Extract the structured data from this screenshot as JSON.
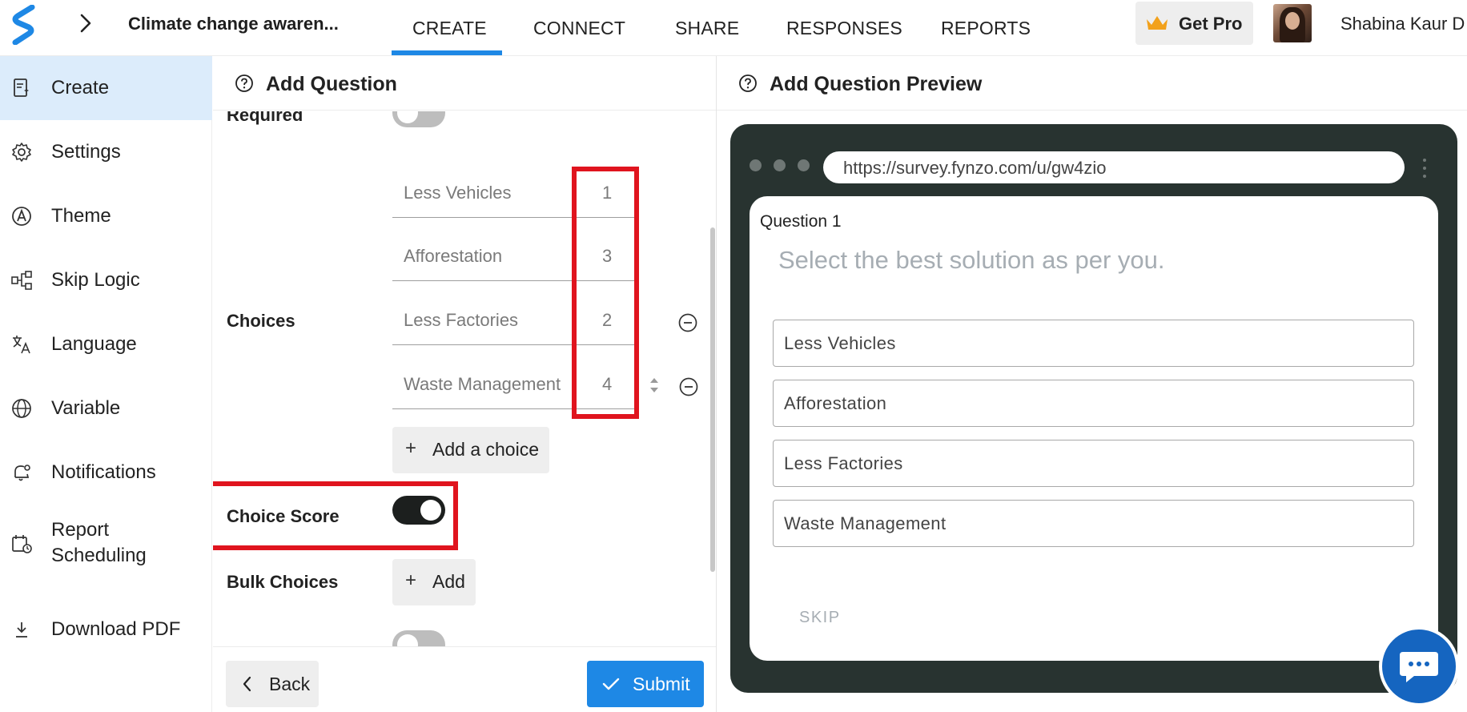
{
  "header": {
    "survey_title": "Climate change awaren...",
    "tabs": [
      {
        "label": "CREATE",
        "active": true
      },
      {
        "label": "CONNECT",
        "active": false
      },
      {
        "label": "SHARE",
        "active": false
      },
      {
        "label": "RESPONSES",
        "active": false
      },
      {
        "label": "REPORTS",
        "active": false
      }
    ],
    "get_pro_label": "Get Pro",
    "user_name": "Shabina Kaur D",
    "accent_color": "#1e88e5"
  },
  "sidebar": {
    "items": [
      {
        "label": "Create",
        "icon": "create-form-icon",
        "active": true
      },
      {
        "label": "Settings",
        "icon": "gear-icon",
        "active": false
      },
      {
        "label": "Theme",
        "icon": "theme-icon",
        "active": false
      },
      {
        "label": "Skip Logic",
        "icon": "skip-logic-icon",
        "active": false
      },
      {
        "label": "Language",
        "icon": "translate-icon",
        "active": false
      },
      {
        "label": "Variable",
        "icon": "globe-icon",
        "active": false
      },
      {
        "label": "Notifications",
        "icon": "bell-icon",
        "active": false
      },
      {
        "label": "Report Scheduling",
        "icon": "calendar-clock-icon",
        "active": false
      },
      {
        "label": "Download PDF",
        "icon": "download-icon",
        "active": false
      }
    ]
  },
  "editor": {
    "title": "Add Question",
    "required_label": "Required",
    "required_on": false,
    "choices_label": "Choices",
    "choices": [
      {
        "text": "Less Vehicles",
        "score": "1"
      },
      {
        "text": "Afforestation",
        "score": "3"
      },
      {
        "text": "Less Factories",
        "score": "2"
      },
      {
        "text": "Waste Management",
        "score": "4"
      }
    ],
    "add_choice_label": "Add a choice",
    "choice_score_label": "Choice Score",
    "choice_score_on": true,
    "bulk_choices_label": "Bulk Choices",
    "bulk_add_label": "Add",
    "back_label": "Back",
    "submit_label": "Submit",
    "highlight_color": "#e0141e"
  },
  "preview": {
    "title": "Add Question Preview",
    "url": "https://survey.fynzo.com/u/gw4zio",
    "question_number": "Question 1",
    "question_text": "Select the best solution as per you.",
    "options": [
      "Less Vehicles",
      "Afforestation",
      "Less Factories",
      "Waste Management"
    ],
    "skip_label": "SKIP",
    "frame_color": "#283330"
  }
}
